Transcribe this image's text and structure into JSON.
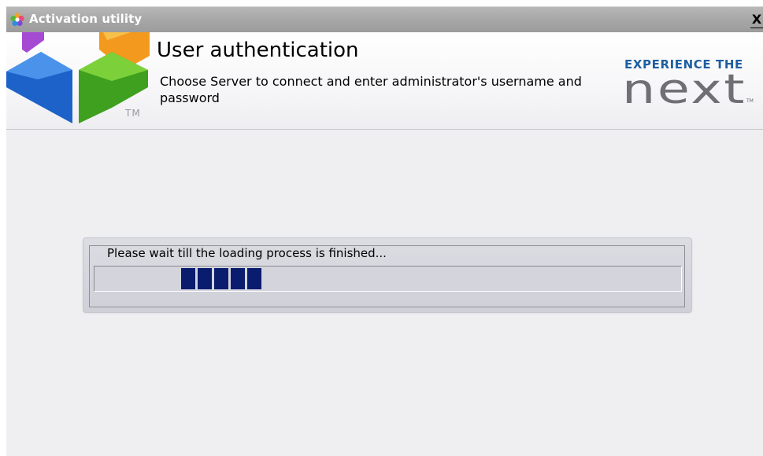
{
  "window": {
    "title": "Activation utility",
    "close_glyph": "X"
  },
  "header": {
    "title": "User authentication",
    "description": "Choose Server to connect and enter administrator's username and password",
    "logo_tm": "TM",
    "brand_tagline": "EXPERIENCE THE",
    "brand_word": "next",
    "brand_tm": "TM"
  },
  "loading": {
    "message": "Please wait till the loading process is finished...",
    "blocks_visible": 5
  },
  "icons": {
    "app": "colorful-flower-icon",
    "close": "close-icon"
  },
  "colors": {
    "titlebar": "#a8a8a8",
    "progress_block": "#0a1c6e",
    "brand_blue": "#1e5fa0",
    "panel": "#d6d6de"
  }
}
